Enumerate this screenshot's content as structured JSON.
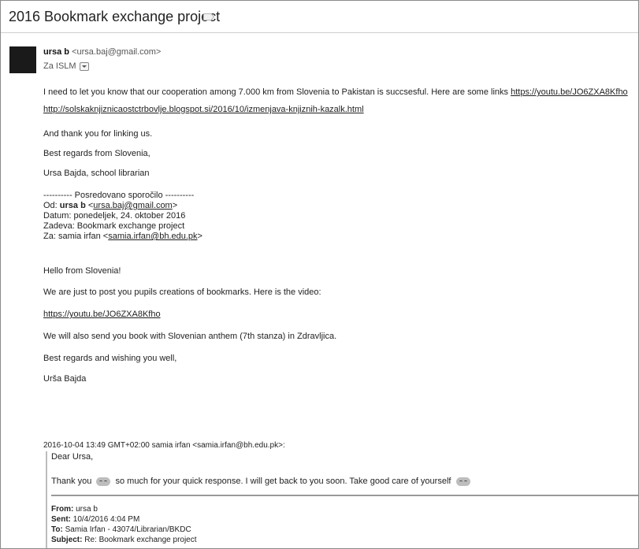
{
  "email": {
    "subject": "2016 Bookmark exchange project",
    "sender_name": "ursa b",
    "sender_email": "<ursa.baj@gmail.com>",
    "to_label": "Za ISLM",
    "body": {
      "line1_text": "I need to let you know that our cooperation among 7.000 km from Slovenia to Pakistan is succsesful. Here are some links ",
      "line1_link": "https://youtu.be/JO6ZXA8Kfho",
      "blog_link": "http://solskaknjiznicaostctrbovlje.blogspot.si/2016/10/izmenjava-knjiznih-kazalk.html",
      "thanks": "And thank you for linking us.",
      "regards": "Best regards from Slovenia,",
      "signature": "Ursa Bajda, school librarian"
    },
    "forwarded": {
      "header": "---------- Posredovano sporočilo ----------",
      "od_label": "Od: ",
      "od_name": "ursa b",
      "od_email_pre": " <",
      "od_email": "ursa.baj@gmail.com",
      "od_email_post": ">",
      "datum": "Datum: ponedeljek, 24. oktober 2016",
      "zadeva": "Zadeva: Bookmark exchange project",
      "za_label": "Za: samia irfan <",
      "za_email": "samia.irfan@bh.edu.pk",
      "za_post": ">",
      "hello": "Hello from Slovenia!",
      "post_text": "We are just to post you pupils creations of bookmarks. Here is the video:",
      "video_link": "https://youtu.be/JO6ZXA8Kfho",
      "anthem": "We will also send you book with Slovenian anthem (7th stanza) in Zdravljica.",
      "wishes": "Best regards and wishing you well,",
      "sign": "Urša Bajda"
    },
    "quoted": {
      "header": "2016-10-04 13:49 GMT+02:00 samia irfan <samia.irfan@bh.edu.pk>:",
      "dear": "Dear Ursa,",
      "thank_a": "Thank you ",
      "thank_b": " so much for your quick response.  I will get back to you soon. Take good care of yourself ",
      "from_label": "From:",
      "from_value": " ursa b",
      "sent_label": "Sent:",
      "sent_value": " 10/4/2016 4:04 PM",
      "to_label": "To:",
      "to_value": " Samia Irfan - 43074/Librarian/BKDC",
      "subject_label": "Subject:",
      "subject_value": " Re: Bookmark exchange project"
    }
  }
}
